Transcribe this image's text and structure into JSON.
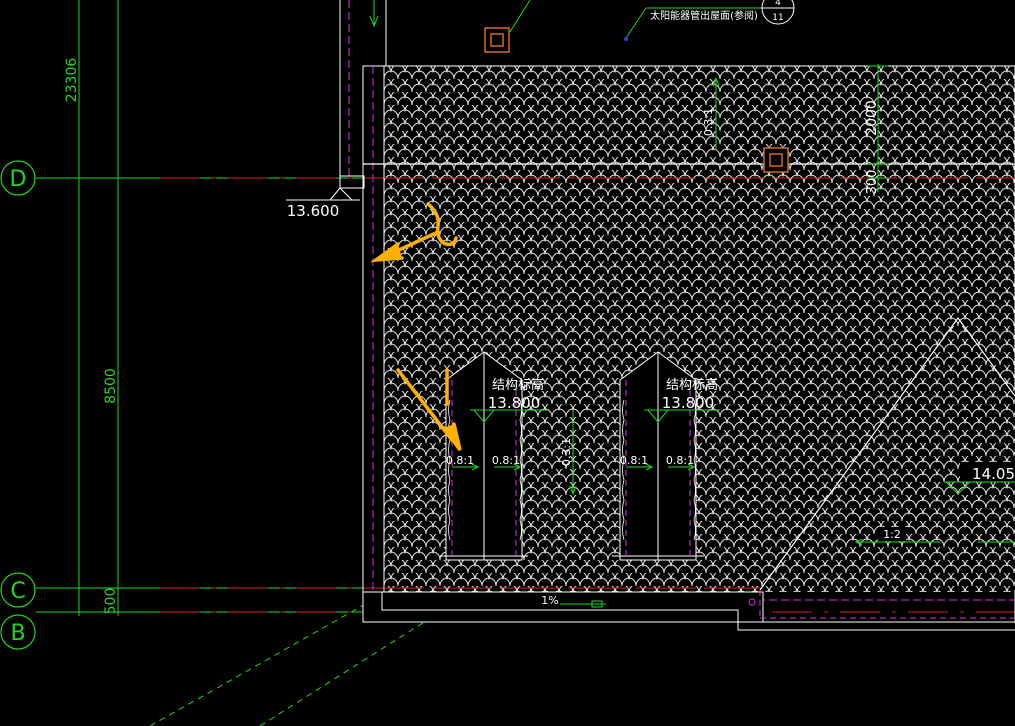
{
  "drawing": {
    "background": "#000000",
    "colors": {
      "grid_line": "#1fd71f",
      "axis_red": "#d81e1e",
      "outline_white": "#ffffff",
      "hidden_magenta": "#d633d6",
      "annotation_orange": "#ffb000",
      "vent_orange": "#d06a22"
    },
    "dimensions": {
      "overall": "23306",
      "span_dc": "8500",
      "span_cb": "500",
      "roof_height": "2000",
      "roof_step": "300"
    },
    "axes": [
      {
        "label": "D"
      },
      {
        "label": "C"
      },
      {
        "label": "B"
      }
    ],
    "elevations": {
      "eave": "13.600",
      "dormer_left_caption": "结构标高",
      "dormer_left_value": "13.800",
      "dormer_right_caption": "结构标高",
      "dormer_right_value": "13.800",
      "ridge_value": "14.05"
    },
    "slopes": {
      "main_roof_top": "0.3:1",
      "main_roof_mid": "0.3:1",
      "dormer_left_a": "0.8:1",
      "dormer_left_b": "0.8:1",
      "dormer_right_a": "0.8:1",
      "dormer_right_b": "0.8:1",
      "hip_roof": "1:2",
      "gutter": "1%"
    },
    "callouts": {
      "top_note": "太阳能器管出屋面(参阅)",
      "index_top": "4",
      "index_bottom": "11"
    }
  }
}
